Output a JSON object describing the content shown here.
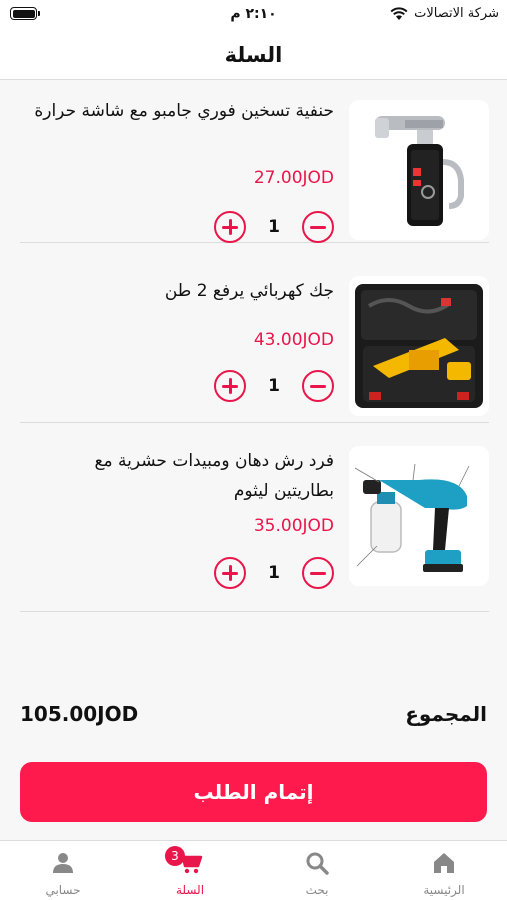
{
  "status_bar": {
    "time": "٢:١٠ م",
    "carrier": "شركة الاتصالات",
    "battery_level": 1.0
  },
  "header": {
    "title": "السلة"
  },
  "cart": {
    "items": [
      {
        "name": "حنفية تسخين فوري جامبو مع شاشة حرارة",
        "price": "27.00JOD",
        "quantity": "1",
        "icon": "faucet-image"
      },
      {
        "name": "جك كهربائي يرفع 2 طن",
        "price": "43.00JOD",
        "quantity": "1",
        "icon": "jack-kit-image"
      },
      {
        "name": "فرد رش دهان ومبيدات حشرية مع بطاريتين ليثوم",
        "price": "35.00JOD",
        "quantity": "1",
        "icon": "spray-gun-image"
      }
    ]
  },
  "summary": {
    "total_label": "المجموع",
    "total_value": "105.00JOD"
  },
  "checkout": {
    "label": "إتمام الطلب"
  },
  "nav": {
    "items": [
      {
        "label": "الرئيسية",
        "icon": "home-icon"
      },
      {
        "label": "بحث",
        "icon": "search-icon"
      },
      {
        "label": "السلة",
        "icon": "cart-icon",
        "badge": "3",
        "active": true
      },
      {
        "label": "حسابي",
        "icon": "user-icon"
      }
    ]
  },
  "colors": {
    "accent": "#e8164a",
    "button": "#ff1a4e",
    "background": "#f7f7f7"
  }
}
